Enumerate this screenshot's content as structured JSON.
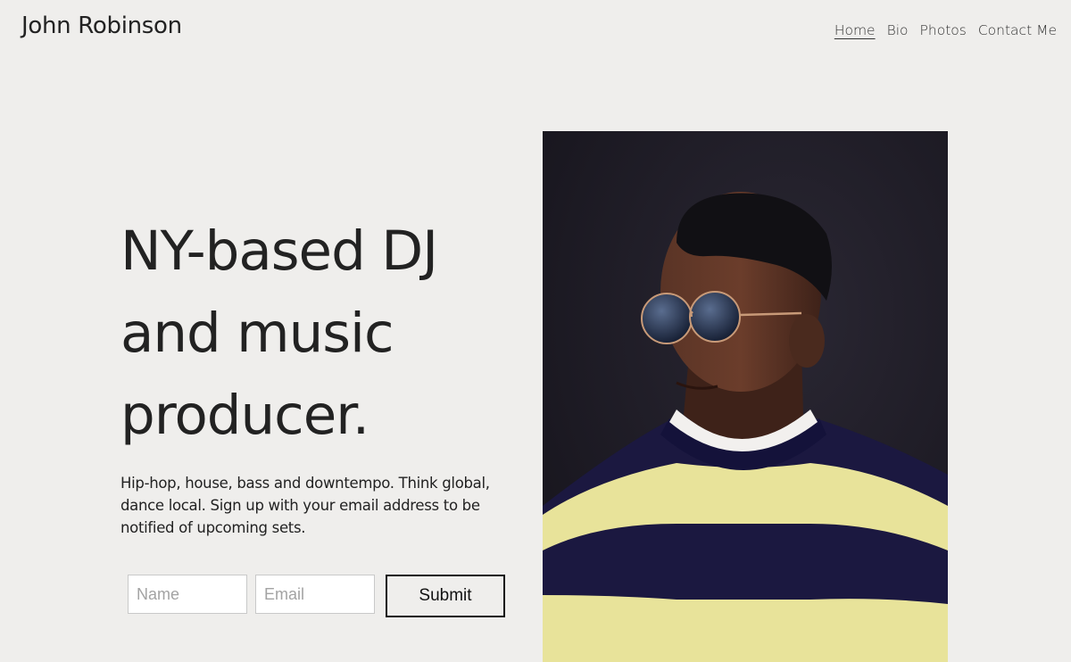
{
  "header": {
    "site_title": "John Robinson",
    "nav": [
      {
        "label": "Home",
        "active": true
      },
      {
        "label": "Bio",
        "active": false
      },
      {
        "label": "Photos",
        "active": false
      },
      {
        "label": "Contact Me",
        "active": false
      }
    ]
  },
  "hero": {
    "headline_lines": [
      "NY-based DJ",
      "and music",
      "producer."
    ],
    "tagline": "Hip-hop, house, bass and downtempo. Think global, dance local. Sign up with your email address to be notified of upcoming sets."
  },
  "signup_form": {
    "name_placeholder": "Name",
    "email_placeholder": "Email",
    "submit_label": "Submit"
  },
  "colors": {
    "background": "#efeeec",
    "text": "#222222",
    "sweater_yellow": "#e8e39a",
    "sweater_navy": "#1b1840"
  }
}
